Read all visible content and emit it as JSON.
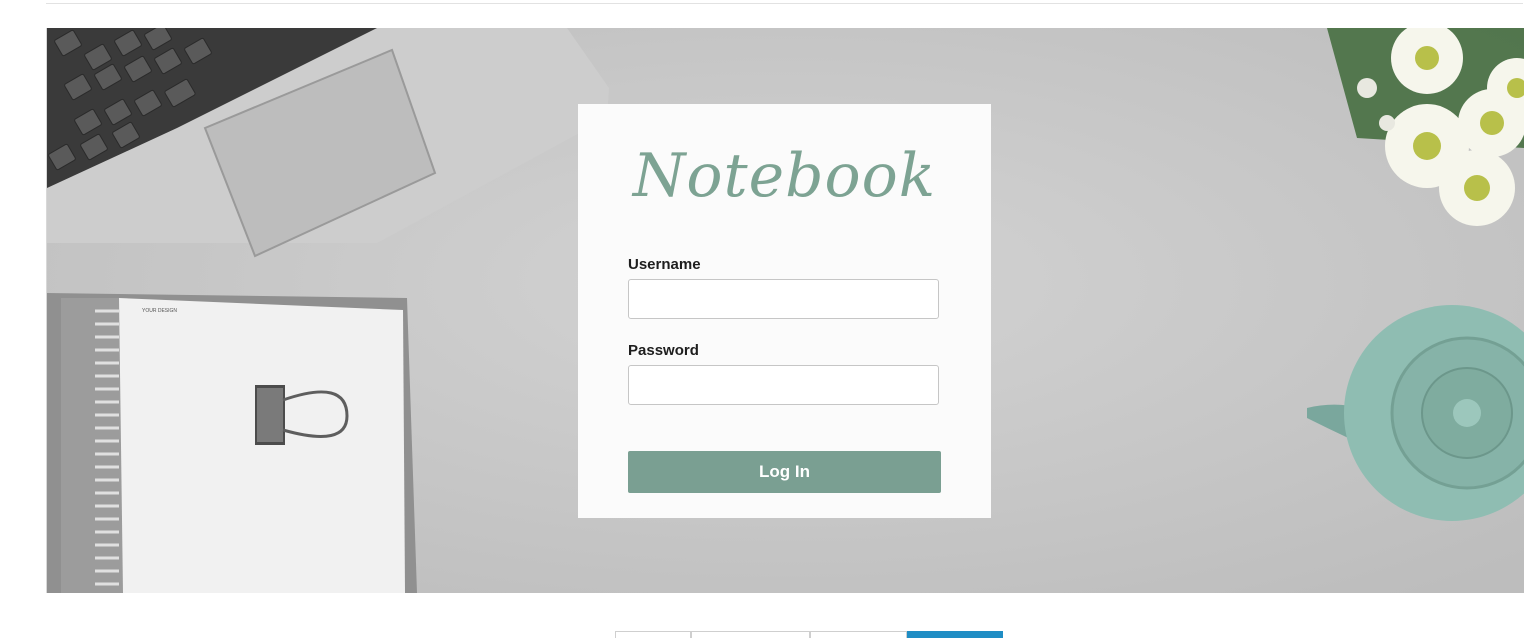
{
  "login": {
    "logo_text": "Notebook",
    "username_label": "Username",
    "username_value": "",
    "password_label": "Password",
    "password_value": "",
    "submit_label": "Log In"
  },
  "hero": {
    "notebook_cover_text": "YOUR DESIGN"
  },
  "colors": {
    "accent": "#7a9f92",
    "logo": "#7da393",
    "active_tab": "#1f8dc4"
  }
}
